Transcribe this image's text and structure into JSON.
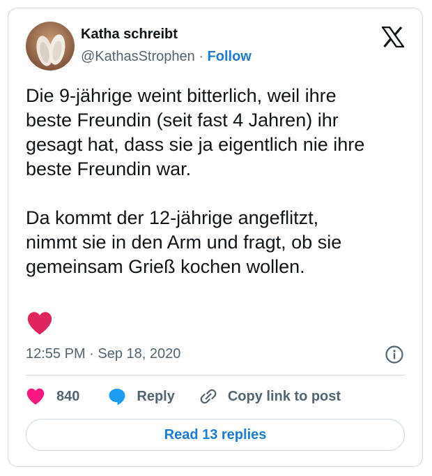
{
  "author": {
    "name": "Katha schreibt",
    "handle": "@KathasStrophen",
    "separator": "·",
    "follow_label": "Follow"
  },
  "tweet": {
    "paragraphs": [
      "Die 9-jährige weint bitterlich, weil ihre\nbeste Freundin (seit fast 4 Jahren) ihr\ngesagt hat, dass sie ja eigentlich nie ihre\nbeste Freundin war.",
      "Da kommt der 12-jährige angeflitzt,\nnimmt sie in den Arm und fragt, ob sie\ngemeinsam Grieß kochen wollen."
    ],
    "timestamp": "12:55 PM · Sep 18, 2020"
  },
  "actions": {
    "like_count": "840",
    "reply_label": "Reply",
    "copy_link_label": "Copy link to post"
  },
  "read_replies_label": "Read 13 replies",
  "icons": {
    "logo": "x-logo-icon",
    "big_heart": "heart-icon",
    "info": "info-icon",
    "like": "heart-icon",
    "reply": "speech-bubble-icon",
    "copy": "link-icon"
  },
  "colors": {
    "text": "#0f1419",
    "secondary_text": "#536471",
    "link_blue": "#1d7bd6",
    "big_heart_red": "#e0245e",
    "like_pink": "#f91880",
    "reply_blue": "#1d9bf0",
    "border": "#cfd9de"
  }
}
